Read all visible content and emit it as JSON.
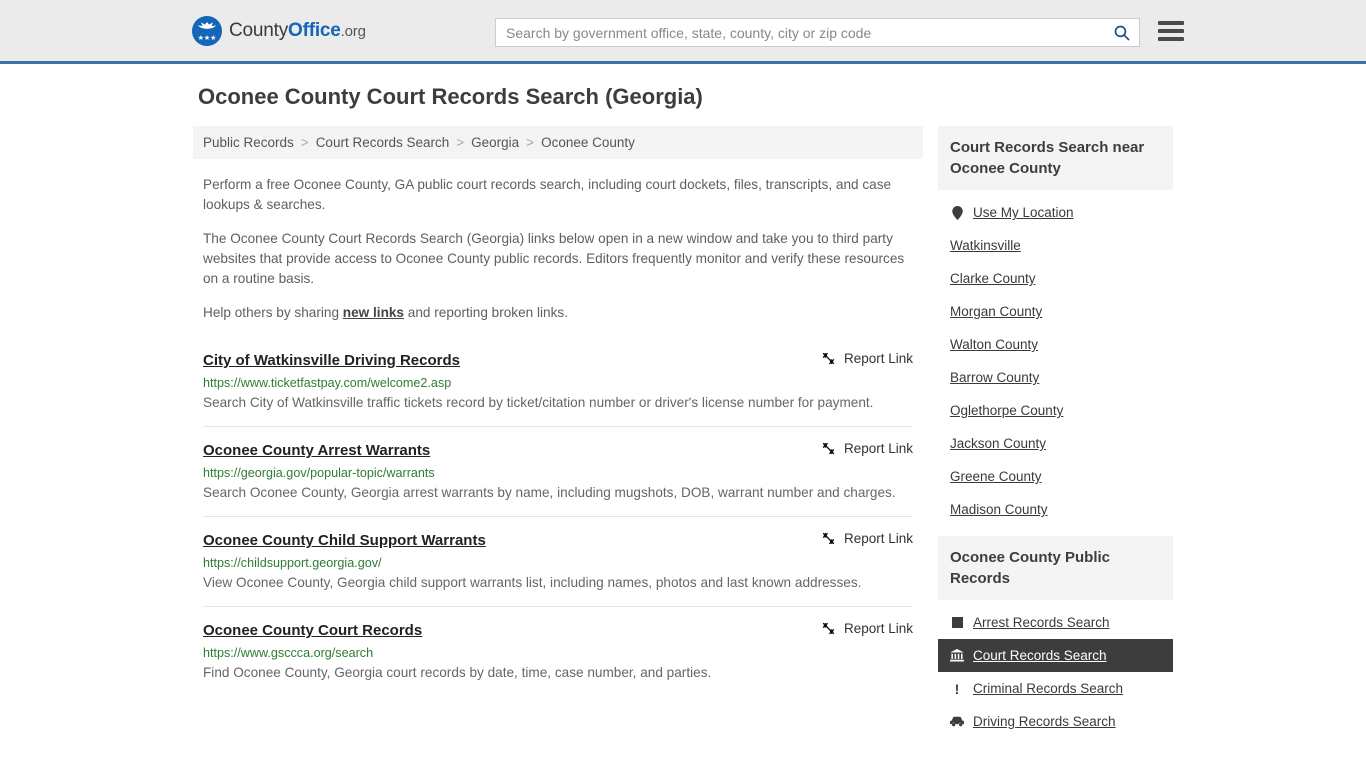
{
  "header": {
    "logo": {
      "name": "CountyOffice.org",
      "part1": "County",
      "part2": "Office",
      "tld": ".org"
    },
    "search": {
      "placeholder": "Search by government office, state, county, city or zip code",
      "value": "",
      "button_icon": "search-icon"
    },
    "menu_icon": "hamburger-menu-icon"
  },
  "page": {
    "title": "Oconee County Court Records Search (Georgia)"
  },
  "breadcrumb": {
    "separator": ">",
    "items": [
      {
        "label": "Public Records"
      },
      {
        "label": "Court Records Search"
      },
      {
        "label": "Georgia"
      },
      {
        "label": "Oconee County"
      }
    ]
  },
  "intro": {
    "paragraph1": "Perform a free Oconee County, GA public court records search, including court dockets, files, transcripts, and case lookups & searches.",
    "paragraph2": "The Oconee County Court Records Search (Georgia) links below open in a new window and take you to third party websites that provide access to Oconee County public records. Editors frequently monitor and verify these resources on a routine basis.",
    "paragraph3_before": "Help others by sharing ",
    "paragraph3_link": "new links",
    "paragraph3_after": " and reporting broken links."
  },
  "report_link_label": "Report Link",
  "results": [
    {
      "title": "City of Watkinsville Driving Records",
      "url": "https://www.ticketfastpay.com/welcome2.asp",
      "description": "Search City of Watkinsville traffic tickets record by ticket/citation number or driver's license number for payment."
    },
    {
      "title": "Oconee County Arrest Warrants",
      "url": "https://georgia.gov/popular-topic/warrants",
      "description": "Search Oconee County, Georgia arrest warrants by name, including mugshots, DOB, warrant number and charges."
    },
    {
      "title": "Oconee County Child Support Warrants",
      "url": "https://childsupport.georgia.gov/",
      "description": "View Oconee County, Georgia child support warrants list, including names, photos and last known addresses."
    },
    {
      "title": "Oconee County Court Records",
      "url": "https://www.gsccca.org/search",
      "description": "Find Oconee County, Georgia court records by date, time, case number, and parties."
    }
  ],
  "sidebar": {
    "nearby": {
      "heading": "Court Records Search near Oconee County",
      "items": [
        {
          "label": "Use My Location",
          "icon": "map-pin-icon"
        },
        {
          "label": "Watkinsville",
          "icon": ""
        },
        {
          "label": "Clarke County",
          "icon": ""
        },
        {
          "label": "Morgan County",
          "icon": ""
        },
        {
          "label": "Walton County",
          "icon": ""
        },
        {
          "label": "Barrow County",
          "icon": ""
        },
        {
          "label": "Oglethorpe County",
          "icon": ""
        },
        {
          "label": "Jackson County",
          "icon": ""
        },
        {
          "label": "Greene County",
          "icon": ""
        },
        {
          "label": "Madison County",
          "icon": ""
        }
      ]
    },
    "public_records": {
      "heading": "Oconee County Public Records",
      "items": [
        {
          "label": "Arrest Records Search",
          "icon": "square-icon",
          "active": false
        },
        {
          "label": "Court Records Search",
          "icon": "bank-icon",
          "active": true
        },
        {
          "label": "Criminal Records Search",
          "icon": "exclamation-icon",
          "active": false
        },
        {
          "label": "Driving Records Search",
          "icon": "car-icon",
          "active": false
        }
      ]
    }
  },
  "colors": {
    "brand_blue": "#1565b8",
    "header_bg": "#ebebeb",
    "header_border": "#3b73a8",
    "url_green": "#2e7d32",
    "active_bg": "#3d3d3d"
  }
}
